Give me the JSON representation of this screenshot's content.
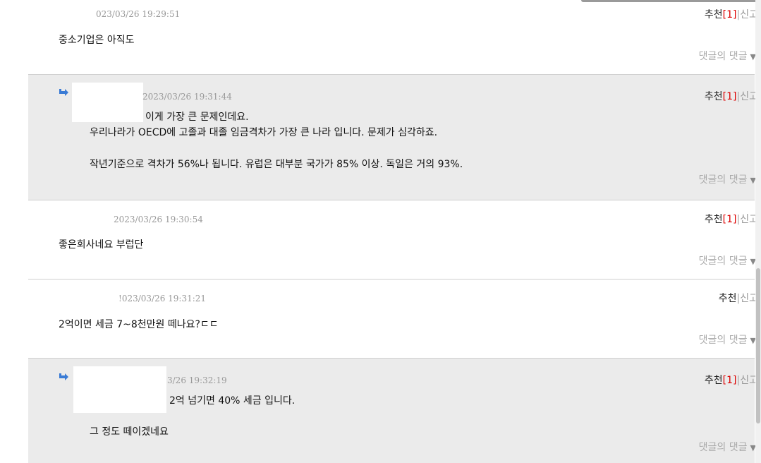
{
  "comments": [
    {
      "date": "023/03/26 19:29:51",
      "lines": [
        "중소기업은 아직도"
      ],
      "recommend": "추천",
      "count": "[1]",
      "report": "신고",
      "sub_reply": "댓글의 댓글"
    },
    {
      "date": "2023/03/26 19:31:44",
      "lines": [
        "이게 가장 큰 문제인데요.",
        "우리나라가 OECD에 고졸과 대졸 임금격차가 가장 큰 나라 입니다. 문제가 심각하죠.",
        "작년기준으로 격차가 56%나 됩니다. 유럽은 대부분 국가가 85% 이상. 독일은 거의 93%."
      ],
      "recommend": "추천",
      "count": "[1]",
      "report": "신고",
      "sub_reply": "댓글의 댓글"
    },
    {
      "date": "2023/03/26 19:30:54",
      "lines": [
        "좋은회사네요 부럽단"
      ],
      "recommend": "추천",
      "count": "[1]",
      "report": "신고",
      "sub_reply": "댓글의 댓글"
    },
    {
      "date": "!023/03/26 19:31:21",
      "lines": [
        "2억이면 세금 7~8천만원 떼나요?ㄷㄷ"
      ],
      "recommend": "추천",
      "count": "",
      "report": "신고",
      "sub_reply": "댓글의 댓글"
    },
    {
      "date": "3/26 19:32:19",
      "lines": [
        "2억 넘기면 40% 세금 입니다.",
        "그 정도 떼이겠네요"
      ],
      "recommend": "추천",
      "count": "[1]",
      "report": "신고",
      "sub_reply": "댓글의 댓글"
    }
  ],
  "icons": {
    "reply_arrow": "reply-arrow-icon",
    "dropdown": "caret-down-icon"
  },
  "colors": {
    "reply_background": "#ebebeb",
    "recommend_count": "#dd0000",
    "reply_arrow": "#3a7bd5",
    "muted_text": "#999999"
  }
}
